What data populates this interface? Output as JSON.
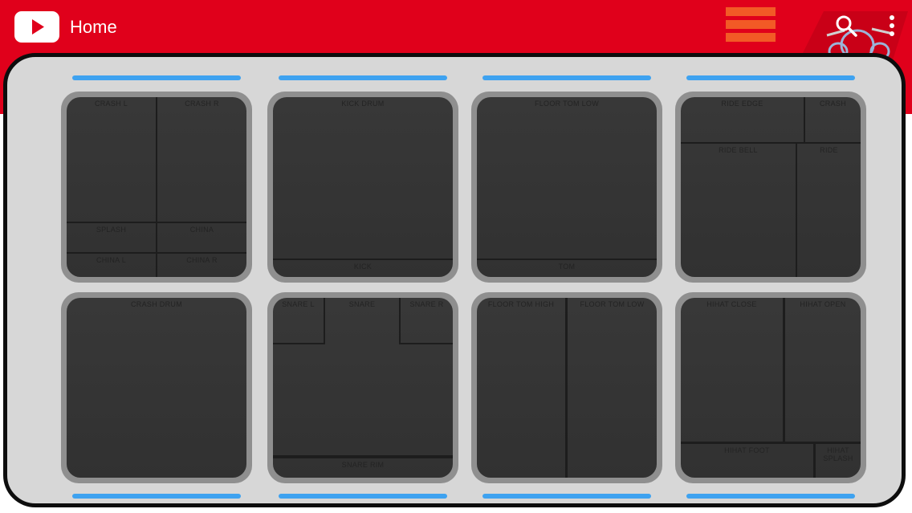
{
  "appbar": {
    "title": "Home",
    "bg_color": "#e0001b",
    "logo_icon": "youtube-play-icon",
    "menu_icon": "hamburger-menu-icon",
    "search_icon": "search-icon",
    "more_icon": "more-vertical-icon",
    "badge_icon": "drum-kit-icon",
    "menu_color": "#f25a26"
  },
  "pads": {
    "p1": {
      "z1": "CRASH L",
      "z2": "CRASH R",
      "z3": "SPLASH",
      "z4": "CHINA",
      "z5": "CHINA L",
      "z6": "CHINA R"
    },
    "p2": {
      "z1": "KICK DRUM",
      "z2": "KICK"
    },
    "p3": {
      "z1": "FLOOR TOM LOW",
      "z2": "TOM"
    },
    "p4": {
      "z1": "RIDE EDGE",
      "z2": "CRASH",
      "z3": "RIDE BELL",
      "z4": "RIDE"
    },
    "p5": {
      "z1": "CRASH DRUM"
    },
    "p6": {
      "z1": "SNARE L",
      "z2": "SNARE",
      "z3": "SNARE R",
      "z4": "SNARE RIM"
    },
    "p7": {
      "z1": "FLOOR TOM HIGH",
      "z2": "FLOOR TOM LOW"
    },
    "p8": {
      "z1": "HIHAT CLOSE",
      "z2": "HIHAT OPEN",
      "z3": "HIHAT FOOT",
      "z4": "HIHAT SPLASH"
    }
  },
  "colors": {
    "indicator": "#3ea2f0",
    "panel": "#d7d7d7",
    "pad_frame": "#8f8f8f",
    "pad_surface": "#363636"
  }
}
